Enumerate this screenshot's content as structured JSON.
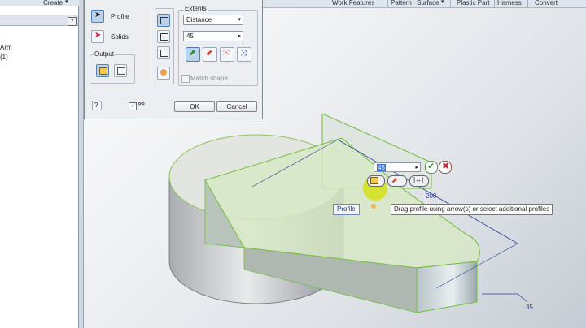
{
  "ribbon": {
    "create": "Create",
    "tabs": [
      "Work Features",
      "Pattern",
      "Surface",
      "Plastic Part",
      "Harness",
      "Convert"
    ]
  },
  "browser": {
    "help": "?",
    "items": [
      "Arm",
      "(1)"
    ]
  },
  "dialog": {
    "profile_label": "Profile",
    "solids_label": "Solids",
    "output_label": "Output",
    "extents_label": "Extents",
    "extent_type": "Distance",
    "distance_value": "45",
    "match_shape_label": "Match shape",
    "ok_label": "OK",
    "cancel_label": "Cancel"
  },
  "viewport": {
    "mini_value": "45",
    "tooltip": "Drag profile using arrow(s) or select additional profiles",
    "profile_tag": "Profile",
    "dim_200": "200",
    "dim_35": "35"
  },
  "colors": {
    "accent": "#4e7fb8",
    "face_green": "#dfe9c8",
    "edge_green": "#6fbf3a",
    "dim_blue": "#2c3f9a"
  },
  "icons": [
    "profile-cursor-icon",
    "solids-icon",
    "extrude-dir-icon",
    "solid-output-icon",
    "surface-output-icon",
    "direction-icon",
    "ok-check-icon",
    "cancel-x-icon",
    "help-icon"
  ]
}
